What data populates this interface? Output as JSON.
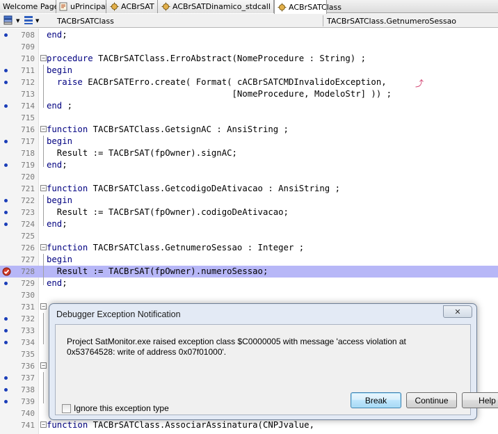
{
  "tabs": [
    {
      "label": "Welcome Page",
      "icon": "none",
      "active": false
    },
    {
      "label": "uPrincipal",
      "icon": "unit-file-icon",
      "active": false
    },
    {
      "label": "ACBrSAT",
      "icon": "unit-file-icon",
      "active": false
    },
    {
      "label": "ACBrSATDinamico_stdcall",
      "icon": "unit-file-icon",
      "active": false
    },
    {
      "label": "ACBrSATClass",
      "icon": "unit-file-icon",
      "active": true
    }
  ],
  "navbar": {
    "class_combo": "TACBrSATClass",
    "method_combo": "TACBrSATClass.GetnumeroSessao"
  },
  "editor": {
    "lines": [
      {
        "n": "708",
        "bp": true,
        "code": "end;"
      },
      {
        "n": "709",
        "bp": false,
        "code": ""
      },
      {
        "n": "710",
        "bp": false,
        "code": "procedure TACBrSATClass.ErroAbstract(NomeProcedure : String) ;"
      },
      {
        "n": "711",
        "bp": true,
        "code": "begin"
      },
      {
        "n": "712",
        "bp": true,
        "code": "  raise EACBrSATErro.create( Format( cACBrSATCMDInvalidoException,"
      },
      {
        "n": "713",
        "bp": false,
        "code": "                                    [NomeProcedure, ModeloStr] )) ;"
      },
      {
        "n": "714",
        "bp": true,
        "code": "end ;"
      },
      {
        "n": "715",
        "bp": false,
        "code": ""
      },
      {
        "n": "716",
        "bp": false,
        "code": "function TACBrSATClass.GetsignAC : AnsiString ;"
      },
      {
        "n": "717",
        "bp": true,
        "code": "begin"
      },
      {
        "n": "718",
        "bp": false,
        "code": "  Result := TACBrSAT(fpOwner).signAC;"
      },
      {
        "n": "719",
        "bp": true,
        "code": "end;"
      },
      {
        "n": "720",
        "bp": false,
        "code": ""
      },
      {
        "n": "721",
        "bp": false,
        "code": "function TACBrSATClass.GetcodigoDeAtivacao : AnsiString ;"
      },
      {
        "n": "722",
        "bp": true,
        "code": "begin"
      },
      {
        "n": "723",
        "bp": true,
        "code": "  Result := TACBrSAT(fpOwner).codigoDeAtivacao;"
      },
      {
        "n": "724",
        "bp": true,
        "code": "end;"
      },
      {
        "n": "725",
        "bp": false,
        "code": ""
      },
      {
        "n": "726",
        "bp": false,
        "code": "function TACBrSATClass.GetnumeroSessao : Integer ;"
      },
      {
        "n": "727",
        "bp": false,
        "code": "begin"
      },
      {
        "n": "728",
        "bp": false,
        "code": "  Result := TACBrSAT(fpOwner).numeroSessao;"
      },
      {
        "n": "729",
        "bp": true,
        "code": "end;"
      },
      {
        "n": "730",
        "bp": false,
        "code": ""
      },
      {
        "n": "731",
        "bp": false,
        "code": ""
      },
      {
        "n": "732",
        "bp": true,
        "code": ""
      },
      {
        "n": "733",
        "bp": true,
        "code": ""
      },
      {
        "n": "734",
        "bp": true,
        "code": ""
      },
      {
        "n": "735",
        "bp": false,
        "code": ""
      },
      {
        "n": "736",
        "bp": false,
        "code": ""
      },
      {
        "n": "737",
        "bp": true,
        "code": ""
      },
      {
        "n": "738",
        "bp": true,
        "code": ""
      },
      {
        "n": "739",
        "bp": true,
        "code": ""
      },
      {
        "n": "740",
        "bp": false,
        "code": ""
      },
      {
        "n": "741",
        "bp": false,
        "code": "function TACBrSATClass.AssociarAssinatura(CNPJvalue,"
      }
    ]
  },
  "dialog": {
    "title": "Debugger Exception Notification",
    "close_label": "✕",
    "message": "Project SatMonitor.exe raised exception class $C0000005 with message 'access violation at 0x53764528: write of address 0x07f01000'.",
    "ignore_label": "Ignore this exception type",
    "break_label": "Break",
    "continue_label": "Continue",
    "help_label": "Help"
  }
}
